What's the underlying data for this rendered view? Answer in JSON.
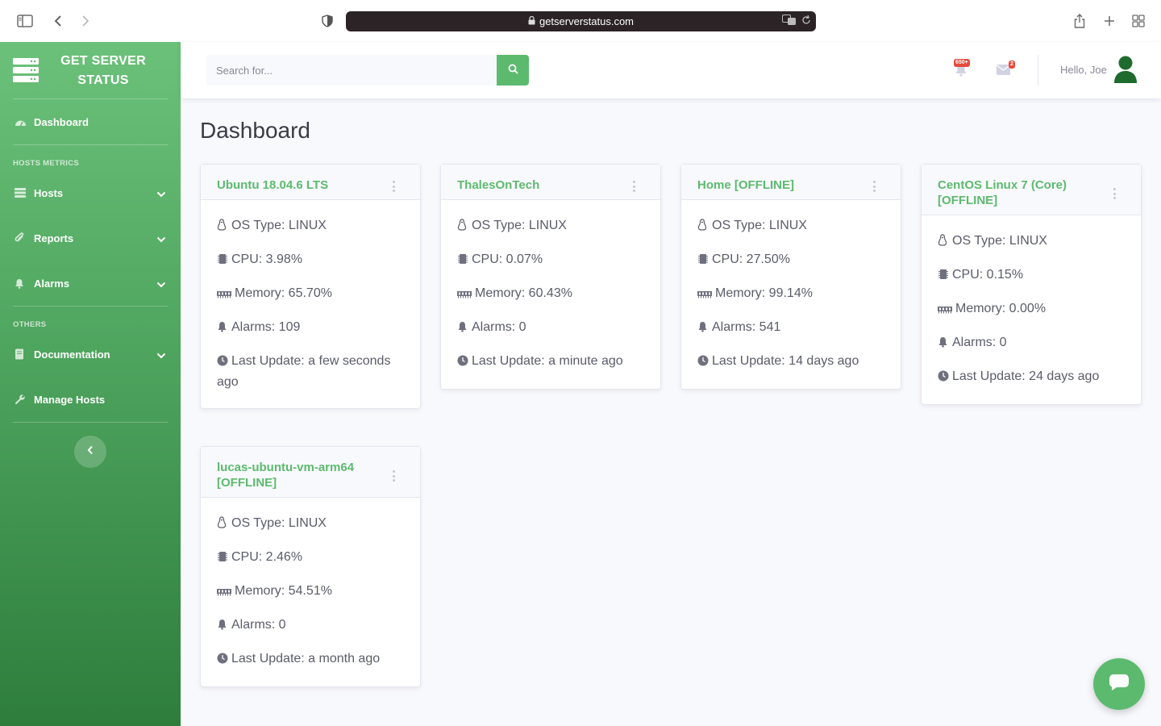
{
  "browser": {
    "url": "getserverstatus.com"
  },
  "sidebar": {
    "brand": "GET SERVER STATUS",
    "dashboard": "Dashboard",
    "heading_hosts": "HOSTS METRICS",
    "hosts": "Hosts",
    "reports": "Reports",
    "alarms": "Alarms",
    "heading_others": "OTHERS",
    "documentation": "Documentation",
    "manage_hosts": "Manage Hosts"
  },
  "topbar": {
    "search_placeholder": "Search for...",
    "alerts_badge": "650+",
    "messages_badge": "2",
    "greeting": "Hello, Joe"
  },
  "page": {
    "title": "Dashboard"
  },
  "hosts": [
    {
      "name": "Ubuntu 18.04.6 LTS",
      "os": "OS Type: LINUX",
      "cpu": "CPU: 3.98%",
      "memory": "Memory: 65.70%",
      "alarms": "Alarms: 109",
      "last_update": "Last Update: a few seconds ago"
    },
    {
      "name": "ThalesOnTech",
      "os": "OS Type: LINUX",
      "cpu": "CPU: 0.07%",
      "memory": "Memory: 60.43%",
      "alarms": "Alarms: 0",
      "last_update": "Last Update: a minute ago"
    },
    {
      "name": "Home [OFFLINE]",
      "os": "OS Type: LINUX",
      "cpu": "CPU: 27.50%",
      "memory": "Memory: 99.14%",
      "alarms": "Alarms: 541",
      "last_update": "Last Update: 14 days ago"
    },
    {
      "name": "CentOS Linux 7 (Core) [OFFLINE]",
      "os": "OS Type: LINUX",
      "cpu": "CPU: 0.15%",
      "memory": "Memory: 0.00%",
      "alarms": "Alarms: 0",
      "last_update": "Last Update: 24 days ago"
    },
    {
      "name": "lucas-ubuntu-vm-arm64 [OFFLINE]",
      "os": "OS Type: LINUX",
      "cpu": "CPU: 2.46%",
      "memory": "Memory: 54.51%",
      "alarms": "Alarms: 0",
      "last_update": "Last Update: a month ago"
    }
  ],
  "icons": {
    "os": "linux-icon",
    "cpu": "microchip-icon",
    "memory": "memory-icon",
    "alarms": "bell-icon",
    "last_update": "clock-icon"
  },
  "colors": {
    "brand_green": "#5cba6e",
    "sidebar_top": "#6cc17a",
    "sidebar_bottom": "#2e7d3c",
    "badge_red": "#e74a3b"
  }
}
